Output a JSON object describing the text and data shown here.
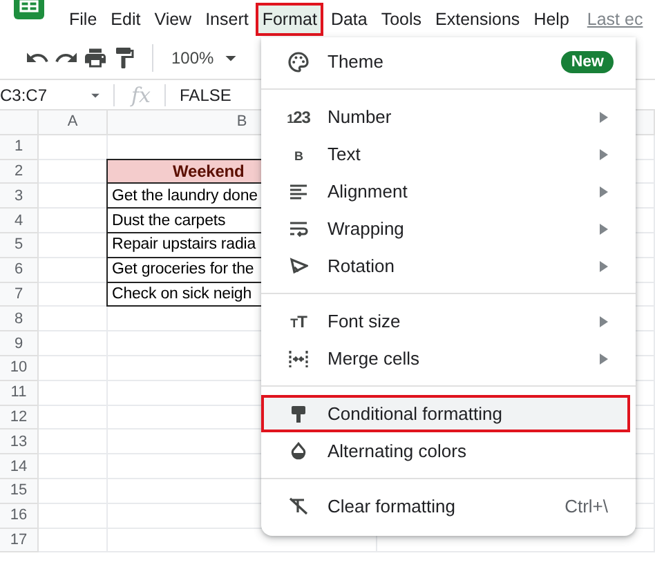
{
  "menu_bar": [
    {
      "label": "File",
      "selected": false
    },
    {
      "label": "Edit",
      "selected": false
    },
    {
      "label": "View",
      "selected": false
    },
    {
      "label": "Insert",
      "selected": false
    },
    {
      "label": "Format",
      "selected": true
    },
    {
      "label": "Data",
      "selected": false
    },
    {
      "label": "Tools",
      "selected": false
    },
    {
      "label": "Extensions",
      "selected": false
    },
    {
      "label": "Help",
      "selected": false
    }
  ],
  "last_edit": "Last ec",
  "toolbar": {
    "zoom": "100%"
  },
  "formula_bar": {
    "cell_ref": "C3:C7",
    "fx_label": "fx",
    "formula": "FALSE"
  },
  "sheet": {
    "columns": [
      "A",
      "B"
    ],
    "rows": [
      "1",
      "2",
      "3",
      "4",
      "5",
      "6",
      "7",
      "8",
      "9",
      "10",
      "11",
      "12",
      "13",
      "14",
      "15",
      "16",
      "17"
    ],
    "table": {
      "header": "Weekend",
      "cells": [
        "Get the laundry done",
        "Dust the carpets",
        "Repair upstairs radia",
        "Get groceries for the",
        "Check on sick neigh"
      ]
    }
  },
  "format_menu": {
    "sections": [
      [
        {
          "label": "Theme",
          "badge": "New",
          "submenu": false,
          "selected": false
        }
      ],
      [
        {
          "label": "Number",
          "icon_text": "123",
          "submenu": true,
          "selected": false
        },
        {
          "label": "Text",
          "icon_text": "B",
          "submenu": true,
          "selected": false
        },
        {
          "label": "Alignment",
          "submenu": true,
          "selected": false
        },
        {
          "label": "Wrapping",
          "submenu": true,
          "selected": false
        },
        {
          "label": "Rotation",
          "submenu": true,
          "selected": false
        }
      ],
      [
        {
          "label": "Font size",
          "icon_text": "TT",
          "submenu": true,
          "selected": false
        },
        {
          "label": "Merge cells",
          "submenu": true,
          "selected": false
        }
      ],
      [
        {
          "label": "Conditional formatting",
          "submenu": false,
          "selected": true
        },
        {
          "label": "Alternating colors",
          "submenu": false,
          "selected": false
        }
      ],
      [
        {
          "label": "Clear formatting",
          "shortcut": "Ctrl+\\",
          "submenu": false,
          "selected": false
        }
      ]
    ]
  }
}
